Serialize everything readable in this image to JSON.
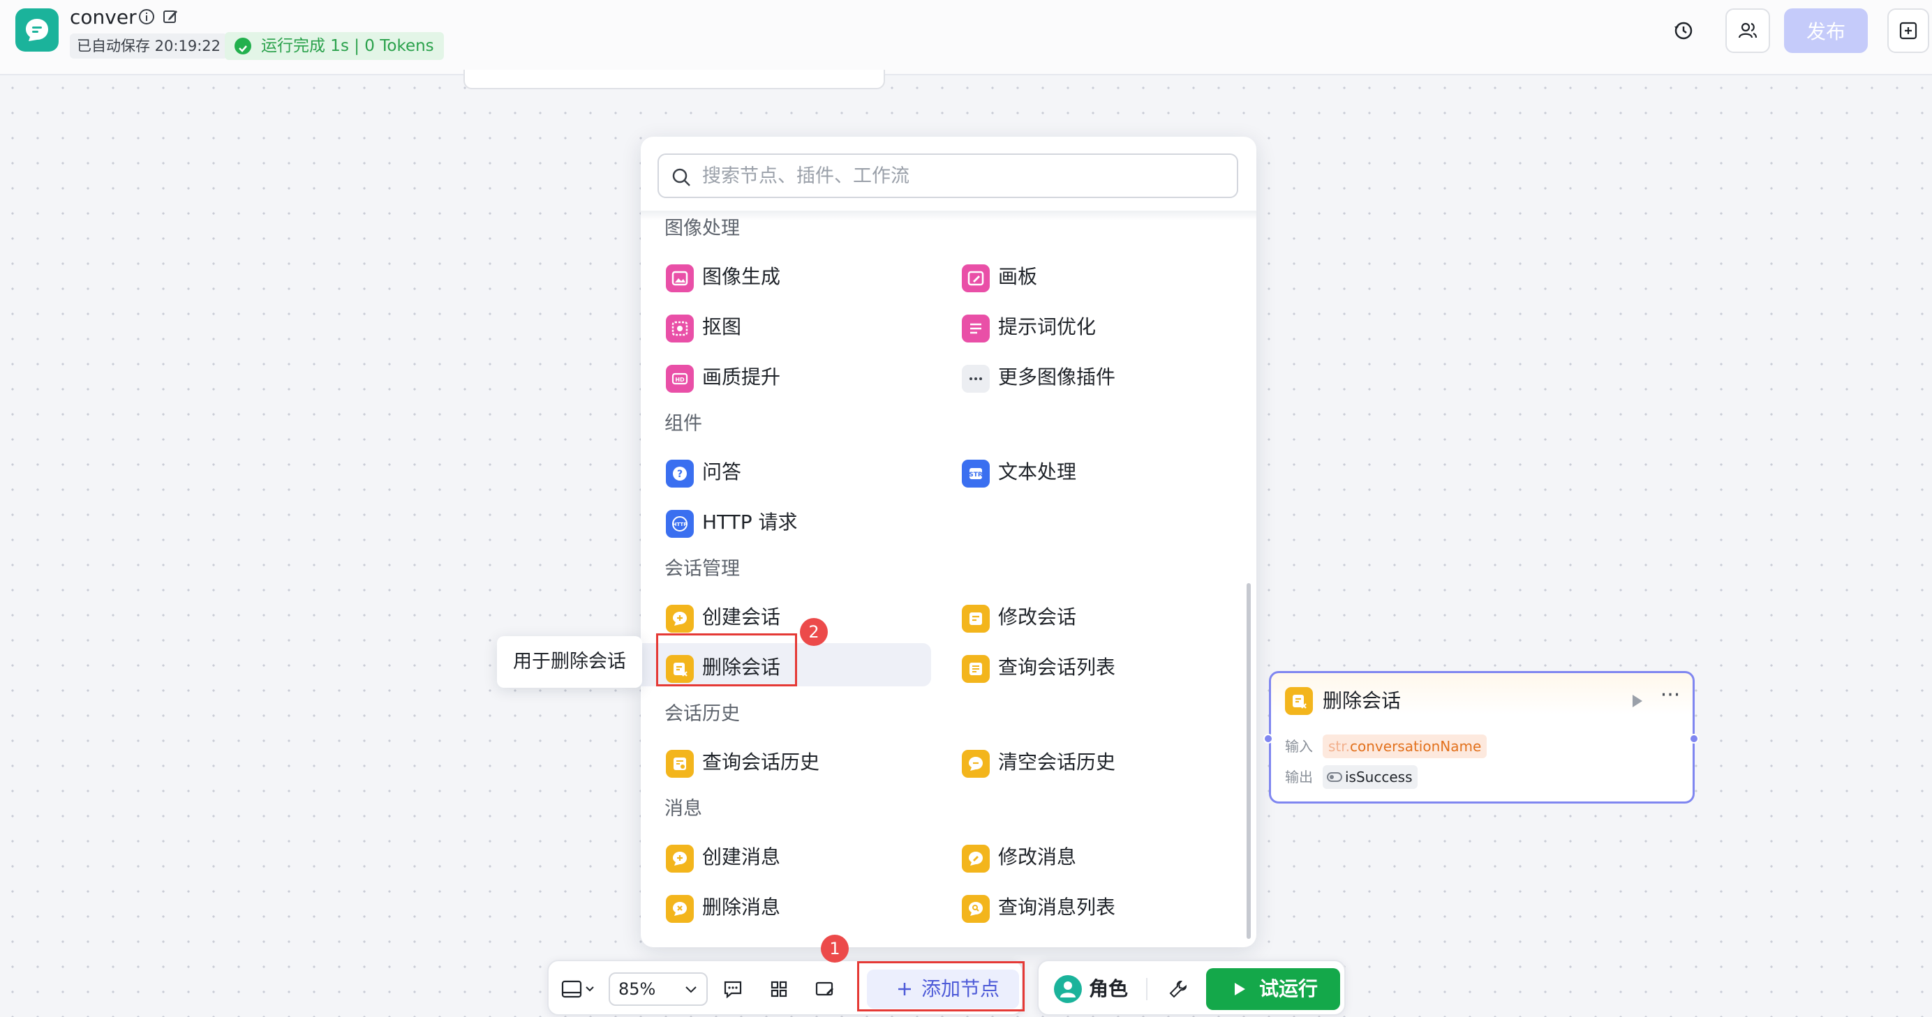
{
  "header": {
    "app_title": "conver",
    "autosave": "已自动保存 20:19:22",
    "run_status": "运行完成 1s | 0 Tokens",
    "publish_label": "发布"
  },
  "panel": {
    "search_placeholder": "搜索节点、插件、工作流",
    "sections": {
      "image": {
        "title": "图像处理",
        "items": [
          "图像生成",
          "画板",
          "抠图",
          "提示词优化",
          "画质提升",
          "更多图像插件"
        ]
      },
      "components": {
        "title": "组件",
        "items": [
          "问答",
          "文本处理",
          "HTTP 请求"
        ]
      },
      "conversation": {
        "title": "会话管理",
        "items": [
          "创建会话",
          "修改会话",
          "删除会话",
          "查询会话列表"
        ]
      },
      "history": {
        "title": "会话历史",
        "items": [
          "查询会话历史",
          "清空会话历史"
        ]
      },
      "message": {
        "title": "消息",
        "items": [
          "创建消息",
          "修改消息",
          "删除消息",
          "查询消息列表"
        ]
      }
    },
    "tooltip": "用于删除会话"
  },
  "markers": {
    "first": "1",
    "second": "2"
  },
  "canvas_node": {
    "title": "删除会话",
    "input_label": "输入",
    "input_type": "str.",
    "input_value": "conversationName",
    "output_label": "输出",
    "output_value": "isSuccess",
    "accent_color": "#7f86f0"
  },
  "toolbar": {
    "zoom": "85%",
    "add_node_label": "添加节点",
    "role_label": "角色",
    "test_run_label": "试运行"
  }
}
